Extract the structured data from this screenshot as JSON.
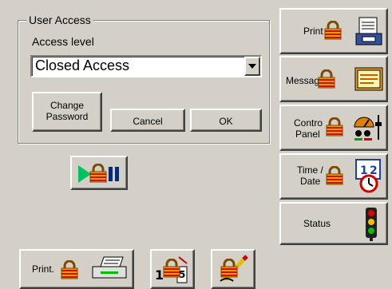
{
  "user_access": {
    "group_title": "User Access",
    "access_level_label": "Access level",
    "access_level_value": "Closed Access",
    "change_password_line1": "Change",
    "change_password_line2": "Password",
    "cancel_label": "Cancel",
    "ok_label": "OK"
  },
  "side_buttons": {
    "print_label": "Print",
    "message_label": "Messag",
    "control_panel_line1": "Contro",
    "control_panel_line2": "Panel",
    "time_date_line1": "Time /",
    "time_date_line2": "Date",
    "status_label": "Status"
  },
  "bottom_buttons": {
    "print_label": "Print."
  },
  "icons": {
    "lock": "padlock-icon",
    "printer": "printer-icon",
    "message": "message-icon",
    "control_panel": "gauge-sliders-icon",
    "time_date": "calendar-clock-icon",
    "status": "traffic-light-icon",
    "play_pause": "play-pause-icon",
    "counter": "counter-icon",
    "edit": "pencil-icon"
  },
  "colors": {
    "background": "#d4d0c8",
    "lock_gold": "#e8a000",
    "lock_red": "#d01010",
    "play_green": "#00c060"
  }
}
